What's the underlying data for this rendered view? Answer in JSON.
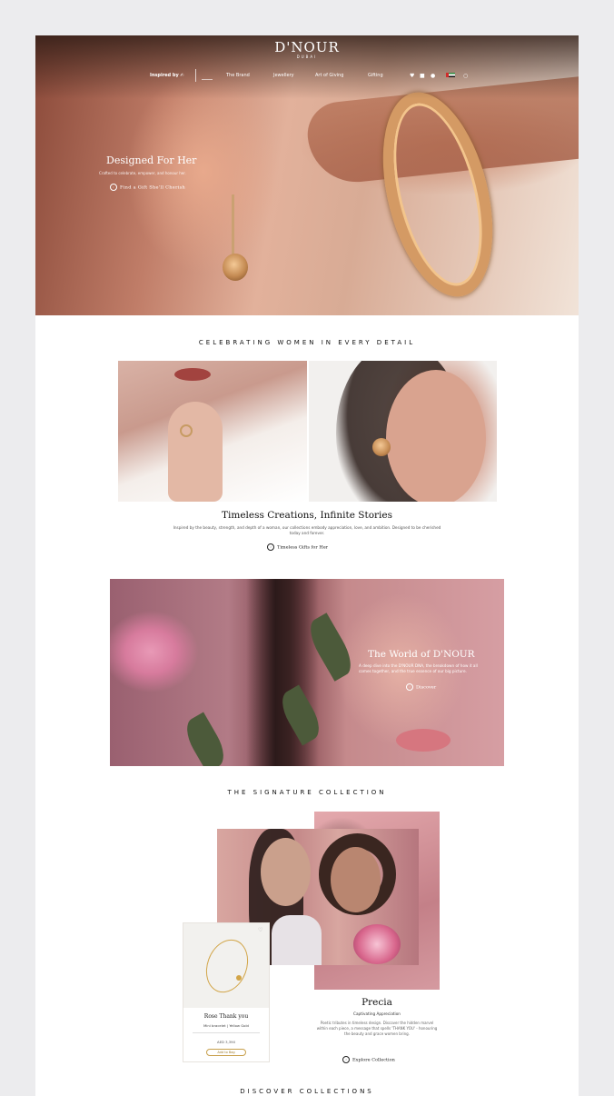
{
  "brand": {
    "logo": "D'NOUR",
    "sub": "DUBAI"
  },
  "nav": {
    "inspired_by": "Inspired by",
    "items": [
      "The Brand",
      "Jewellery",
      "Art of Giving",
      "Gifting"
    ]
  },
  "hero": {
    "title": "Designed For Her",
    "subtitle": "Crafted to celebrate, empower, and honour her.",
    "cta": "Find a Gift She'll Cherish"
  },
  "section1": {
    "heading": "CELEBRATING WOMEN IN EVERY DETAIL",
    "title": "Timeless Creations, Infinite Stories",
    "paragraph": "Inspired by the beauty, strength, and depth of a woman, our collections embody appreciation, love, and ambition. Designed to be cherished today and forever.",
    "cta": "Timeless Gifts for Her"
  },
  "world": {
    "title": "The World of D'NOUR",
    "subtitle": "A deep dive into the D'NOUR DNA, the breakdown of how it all comes together, and the true essence of our big picture.",
    "cta": "Discover"
  },
  "signature": {
    "heading": "THE SIGNATURE COLLECTION",
    "product": {
      "name": "Rose Thank you",
      "meta": "Mini bracelet | Yellow Gold",
      "price": "AED 3,390",
      "button": "Add to Bag"
    },
    "collection_title": "Precia",
    "collection_subtitle": "Captivating Appreciation",
    "collection_desc": "Poetic tributes in timeless design. Discover the hidden marvel within each piece, a message that spells 'THANK YOU' - honouring the beauty and grace women bring.",
    "cta": "Explore Collection"
  },
  "discover": {
    "heading": "DISCOVER COLLECTIONS"
  },
  "icons": [
    "heart-icon",
    "bag-icon",
    "user-icon",
    "uae-flag-icon",
    "search-icon",
    "arrow-circle-icon"
  ],
  "colors": {
    "gold": "#c8a04c",
    "text": "#111111",
    "page_bg": "#ececee"
  }
}
